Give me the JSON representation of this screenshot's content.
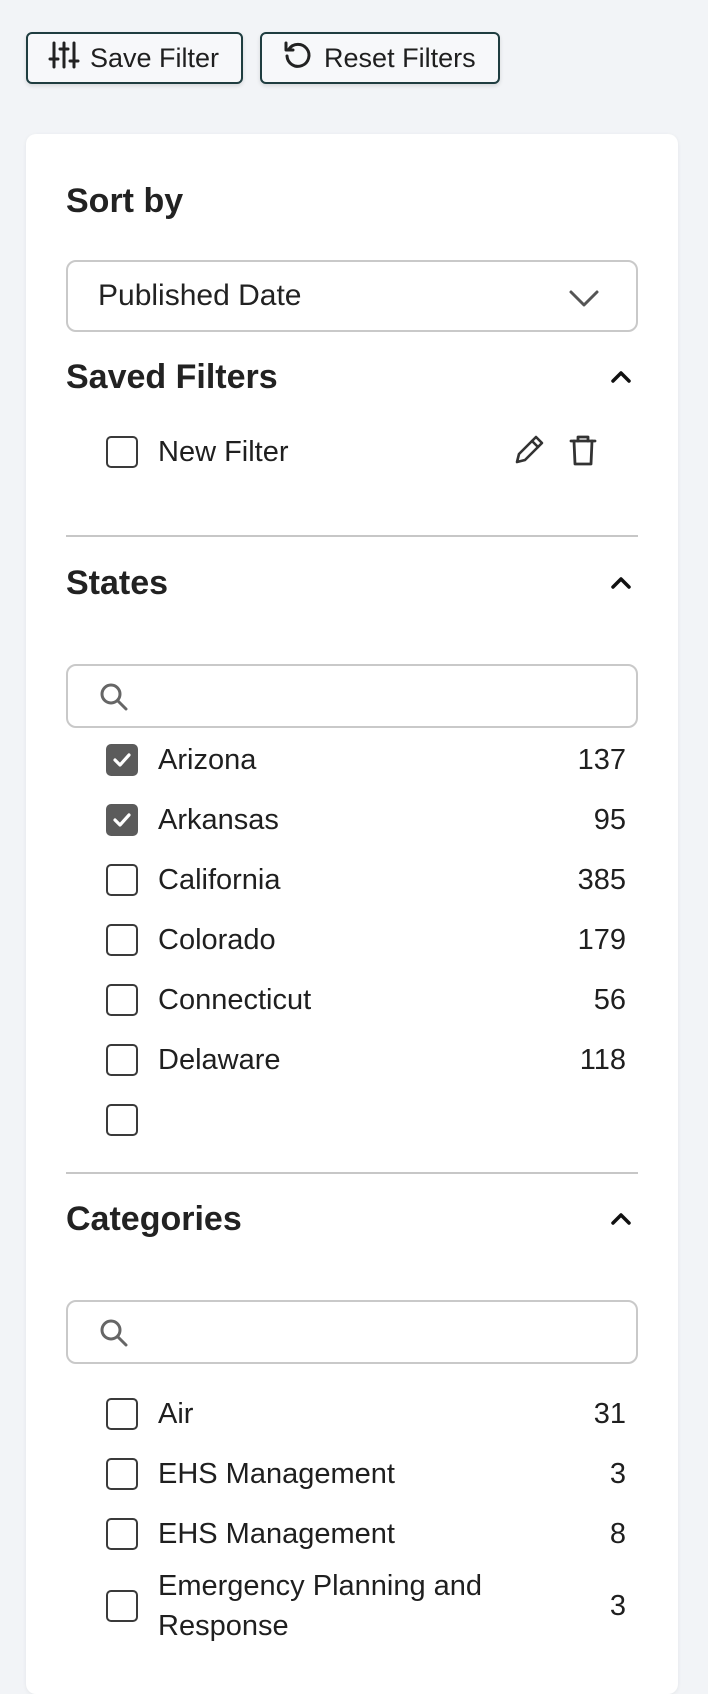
{
  "toolbar": {
    "save_label": "Save Filter",
    "reset_label": "Reset Filters",
    "save_icon": "sliders-icon",
    "reset_icon": "refresh-icon"
  },
  "sort": {
    "heading": "Sort by",
    "selected": "Published Date"
  },
  "saved_filters": {
    "heading": "Saved Filters",
    "items": [
      {
        "label": "New Filter",
        "checked": false
      }
    ]
  },
  "states": {
    "heading": "States",
    "search_placeholder": "",
    "items": [
      {
        "label": "Arizona",
        "count": "137",
        "checked": true
      },
      {
        "label": "Arkansas",
        "count": "95",
        "checked": true
      },
      {
        "label": "California",
        "count": "385",
        "checked": false
      },
      {
        "label": "Colorado",
        "count": "179",
        "checked": false
      },
      {
        "label": "Connecticut",
        "count": "56",
        "checked": false
      },
      {
        "label": "Delaware",
        "count": "118",
        "checked": false
      }
    ]
  },
  "categories": {
    "heading": "Categories",
    "search_placeholder": "",
    "items": [
      {
        "label": "Air",
        "count": "31",
        "checked": false
      },
      {
        "label": "EHS Management",
        "count": "3",
        "checked": false
      },
      {
        "label": "EHS Management",
        "count": "8",
        "checked": false
      },
      {
        "label": "Emergency Planning and Response",
        "count": "3",
        "checked": false
      }
    ]
  },
  "colors": {
    "button_border": "#1f3d40",
    "checkbox_checked": "#5b5b5b",
    "page_bg": "#f2f4f7"
  }
}
